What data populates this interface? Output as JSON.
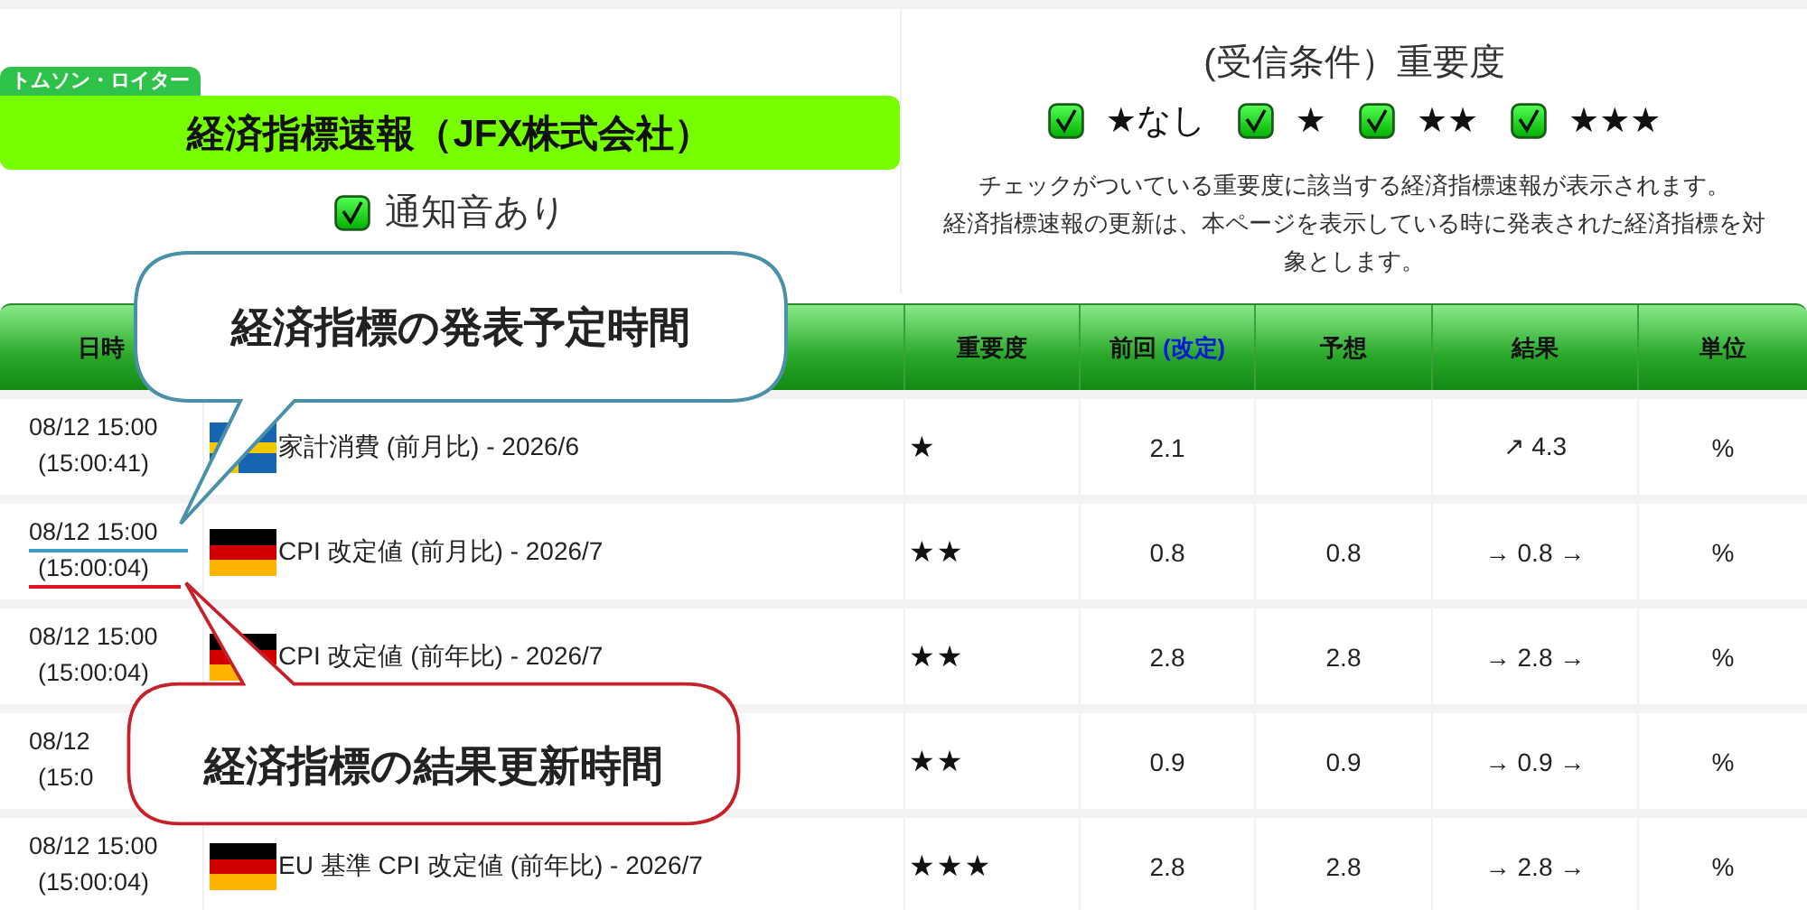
{
  "brand_tag": "トムソン・ロイター",
  "title": "経済指標速報（JFX株式会社）",
  "sound": {
    "label": "通知音あり",
    "checked": true
  },
  "filter": {
    "title": "(受信条件）重要度",
    "options": [
      {
        "label": "★なし",
        "checked": true
      },
      {
        "label": "★",
        "checked": true
      },
      {
        "label": "★★",
        "checked": true
      },
      {
        "label": "★★★",
        "checked": true
      }
    ],
    "notes": [
      "チェックがついている重要度に該当する経済指標速報が表示されます。",
      "経済指標速報の更新は、本ページを表示している時に発表された経済指標を対象とします。"
    ]
  },
  "header": {
    "date": "日時",
    "importance": "重要度",
    "previous": "前回",
    "previous_note": "(改定)",
    "forecast": "予想",
    "result": "結果",
    "unit": "単位"
  },
  "rows": [
    {
      "date": "08/12 15:00",
      "time": "(15:00:41)",
      "kind": "sweden-flag",
      "underlined": false,
      "indicator": "家計消費 (前月比) - 2026/6",
      "importance": "★",
      "previous": "2.1",
      "result": "↗ 4.3",
      "unit": "%"
    },
    {
      "date": "08/12 15:00",
      "time": "(15:00:04)",
      "kind": "germany-flag",
      "underlined": true,
      "indicator": "CPI 改定値 (前月比) - 2026/7",
      "importance": "★★",
      "previous": "0.8",
      "forecast": "0.8",
      "result": "→ 0.8 →",
      "unit": "%"
    },
    {
      "date": "08/12 15:00",
      "time": "(15:00:04)",
      "kind": "germany-flag",
      "underlined": false,
      "indicator": "CPI 改定値 (前年比) - 2026/7",
      "importance": "★★",
      "previous": "2.8",
      "forecast": "2.8",
      "result": "→ 2.8 →",
      "unit": "%"
    },
    {
      "date": "08/12",
      "time": "(15:0",
      "underlined": false,
      "importance": "★★",
      "previous": "0.9",
      "forecast": "0.9",
      "result": "→ 0.9 →",
      "unit": "%"
    },
    {
      "date": "08/12 15:00",
      "time": "(15:00:04)",
      "kind": "germany-flag",
      "underlined": false,
      "indicator": "EU 基準 CPI 改定値 (前年比) - 2026/7",
      "importance": "★★★",
      "previous": "2.8",
      "forecast": "2.8",
      "result": "→ 2.8 →",
      "unit": "%"
    }
  ],
  "callouts": [
    {
      "kind": "schedule",
      "text": "経済指標の発表予定時間"
    },
    {
      "kind": "update",
      "text": "経済指標の結果更新時間"
    }
  ]
}
